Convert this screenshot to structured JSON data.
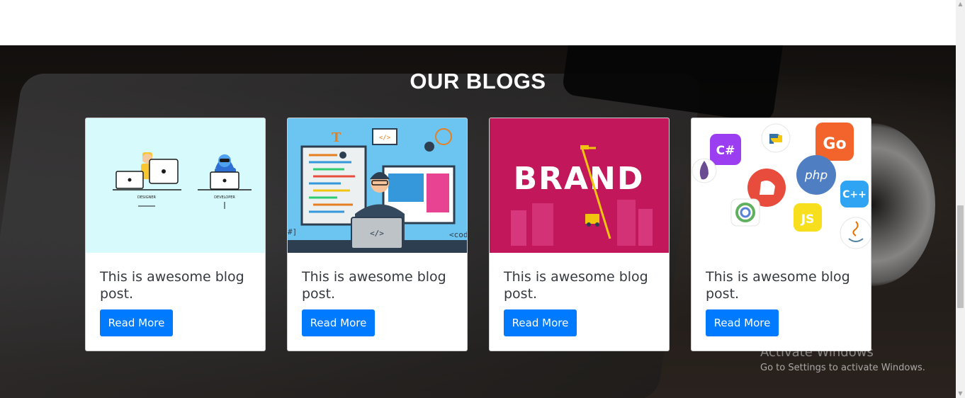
{
  "section": {
    "title": "OUR BLOGS"
  },
  "cards": [
    {
      "title": "This is awesome blog post.",
      "button": "Read More",
      "image": {
        "labels": [
          "DESIGNER",
          "DEVELOPER"
        ]
      }
    },
    {
      "title": "This is awesome blog post.",
      "button": "Read More",
      "image": {
        "labels": [
          "T",
          "</>",
          "</>",
          "<cod",
          "#]"
        ]
      }
    },
    {
      "title": "This is awesome blog post.",
      "button": "Read More",
      "image": {
        "labels": [
          "BRAND"
        ]
      }
    },
    {
      "title": "This is awesome blog post.",
      "button": "Read More",
      "image": {
        "labels": [
          "C#",
          "Go",
          "php",
          "C++",
          "JS"
        ]
      }
    }
  ],
  "watermark": {
    "title": "Activate Windows",
    "subtitle": "Go to Settings to activate Windows."
  },
  "colors": {
    "primary": "#007bff",
    "card_title": "#343a40",
    "brand_bg": "#c2185b",
    "designer_bg": "#d7fafc",
    "coder_bg": "#6cc5f0"
  }
}
